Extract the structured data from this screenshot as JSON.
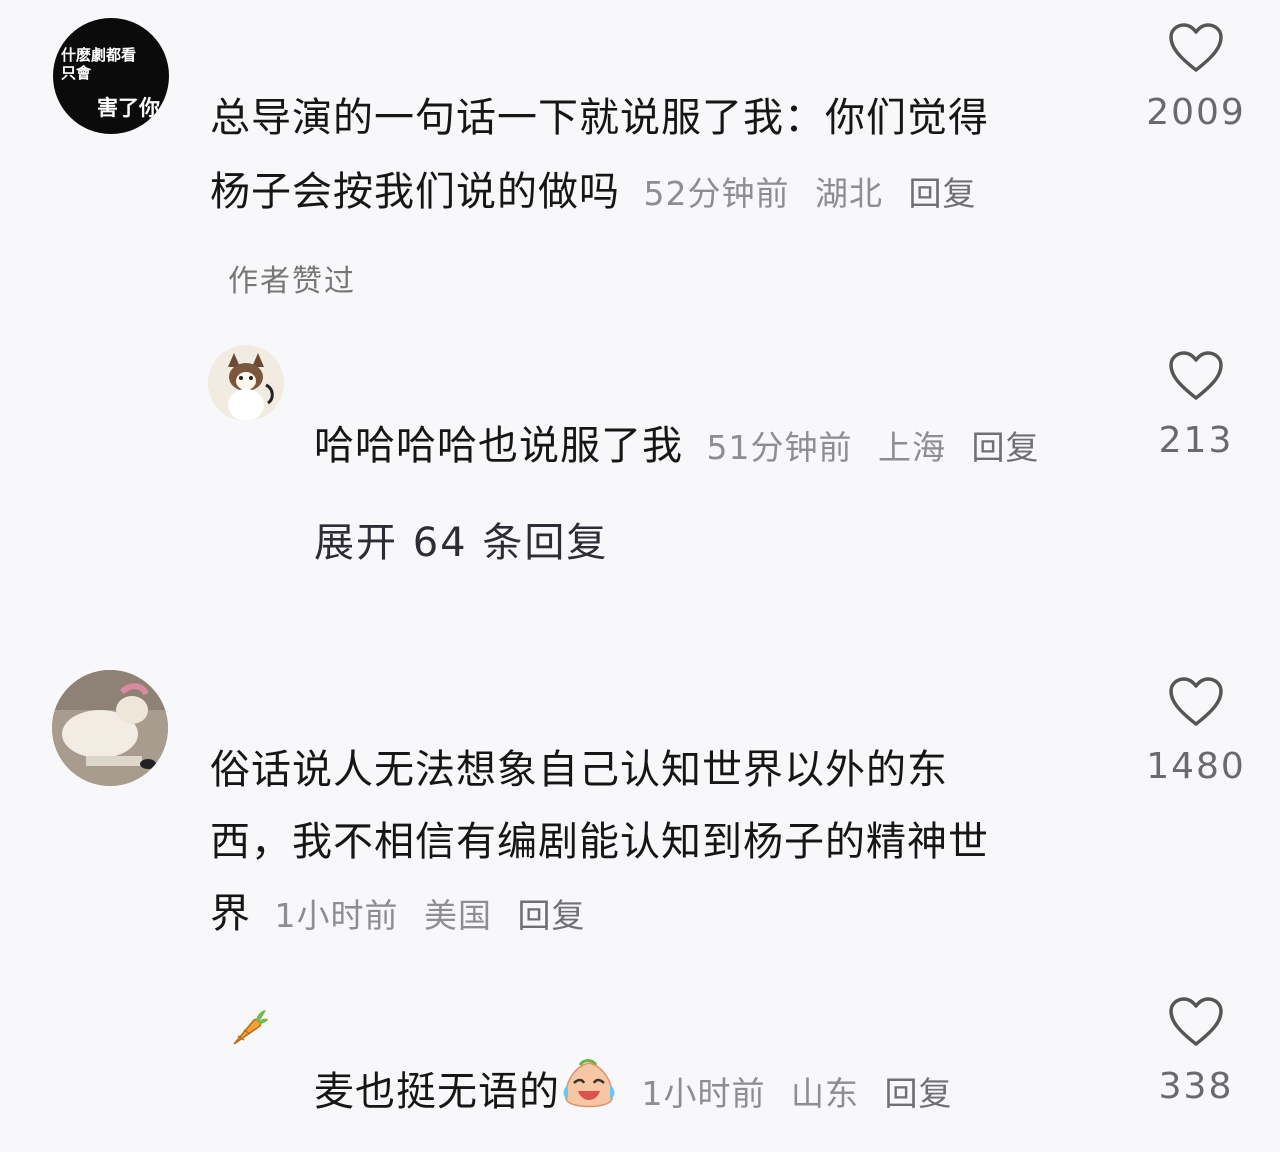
{
  "comments": [
    {
      "avatar_text_line1": "什麽劇都看",
      "avatar_text_line2": "只會",
      "avatar_text_line3": "害了你",
      "text_line1": "总导演的一句话一下就说服了我：你们觉得",
      "text_line2": "杨子会按我们说的做吗",
      "time": "52分钟前",
      "location": "湖北",
      "reply_label": "回复",
      "likes": "2009",
      "author_liked_label": "作者赞过"
    },
    {
      "text": "哈哈哈哈也说服了我",
      "time": "51分钟前",
      "location": "上海",
      "reply_label": "回复",
      "likes": "213",
      "expand_label": "展开 64 条回复"
    },
    {
      "text_line1": "俗话说人无法想象自己认知世界以外的东",
      "text_line2": "西，我不相信有编剧能认知到杨子的精神世",
      "text_line3": "界",
      "time": "1小时前",
      "location": "美国",
      "reply_label": "回复",
      "likes": "1480"
    },
    {
      "text": "麦也挺无语的",
      "emoji_icon": "crying-laughing-emoji",
      "time": "1小时前",
      "location": "山东",
      "reply_label": "回复",
      "likes": "338"
    }
  ],
  "icons": {
    "like": "heart-outline-icon",
    "avatar2": "cat-avatar",
    "avatar3": "cat-photo-avatar",
    "avatar4": "carrot-icon"
  },
  "colors": {
    "background": "#f8f8fa",
    "text": "#161616",
    "meta": "#8d8d92",
    "like_count": "#6a6a6e"
  }
}
